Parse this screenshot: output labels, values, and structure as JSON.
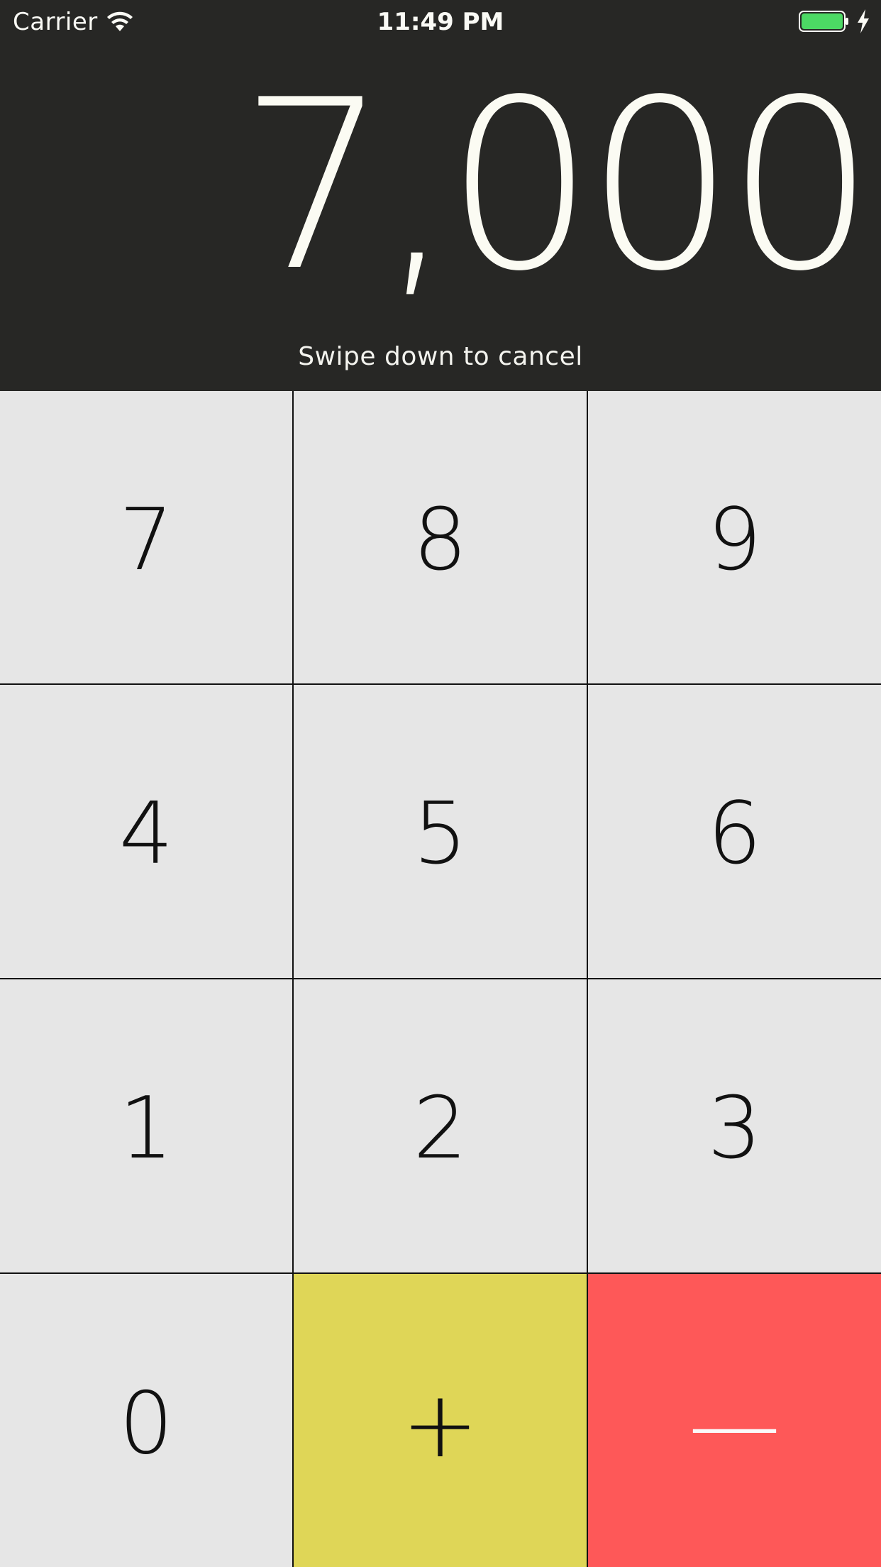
{
  "status_bar": {
    "carrier": "Carrier",
    "time": "11:49 PM",
    "wifi_icon": "wifi-icon",
    "battery_icon": "battery-charging-icon",
    "battery_color": "#4cd964"
  },
  "display": {
    "value": "7,000",
    "hint": "Swipe down to cancel"
  },
  "keypad": {
    "rows": [
      [
        "7",
        "8",
        "9"
      ],
      [
        "4",
        "5",
        "6"
      ],
      [
        "1",
        "2",
        "3"
      ],
      [
        "0",
        "+",
        "—"
      ]
    ],
    "plus_color": "#dfd657",
    "minus_color": "#fe5858",
    "key_color": "#e6e6e6"
  }
}
